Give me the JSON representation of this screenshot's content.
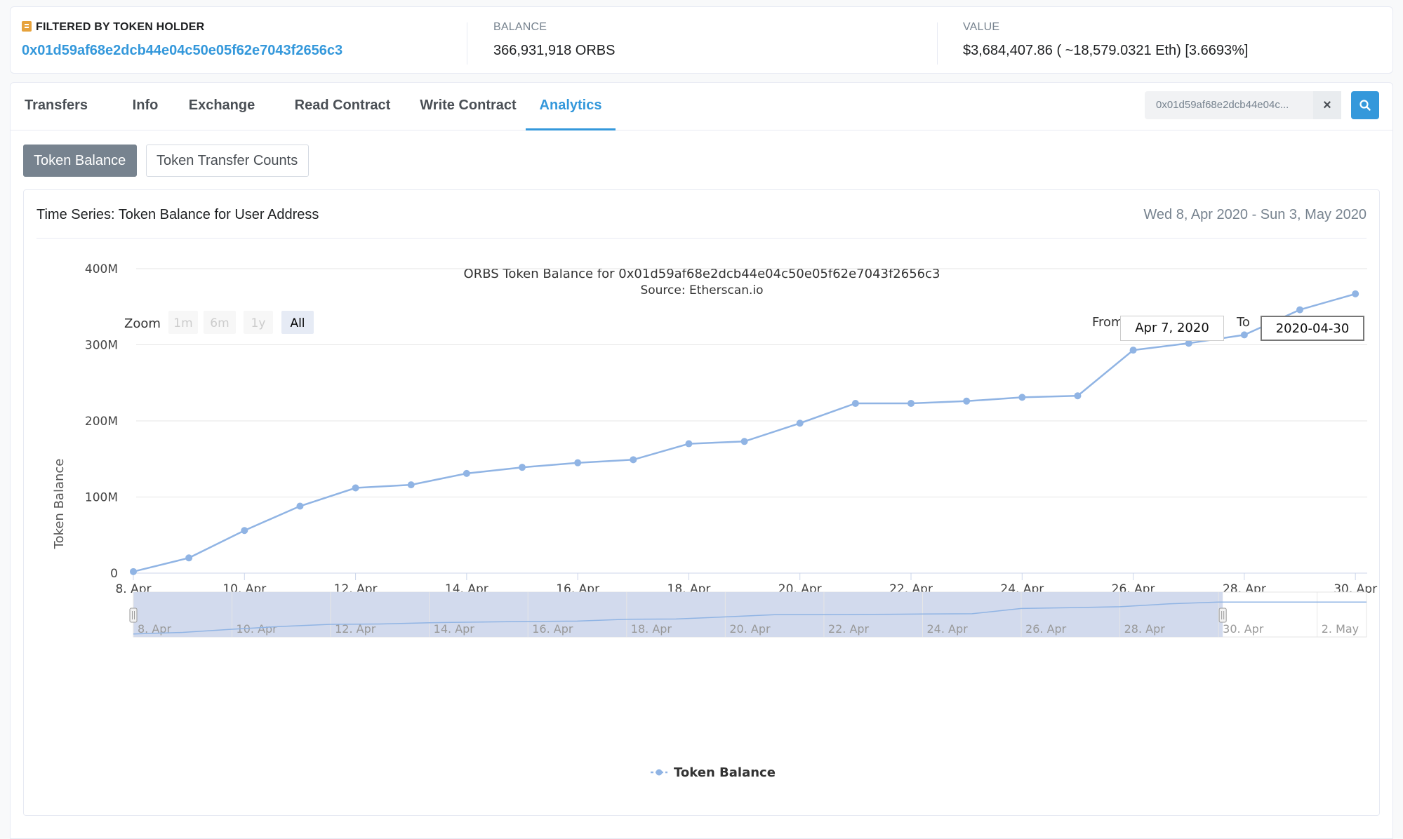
{
  "header": {
    "filter_label": "FILTERED BY TOKEN HOLDER",
    "holder_address": "0x01d59af68e2dcb44e04c50e05f62e7043f2656c3",
    "balance_label": "BALANCE",
    "balance_value": "366,931,918 ORBS",
    "value_label": "VALUE",
    "value_value": "$3,684,407.86 ( ~18,579.0321 Eth) [3.6693%]"
  },
  "tabs": [
    {
      "label": "Transfers"
    },
    {
      "label": "Info"
    },
    {
      "label": "Exchange"
    },
    {
      "label": "Read Contract"
    },
    {
      "label": "Write Contract"
    },
    {
      "label": "Analytics"
    }
  ],
  "search": {
    "value": "0x01d59af68e2dcb44e04c...",
    "clear_glyph": "×",
    "icon": "search-icon"
  },
  "subtabs": {
    "token_balance": "Token Balance",
    "transfer_counts": "Token Transfer Counts"
  },
  "panel": {
    "title": "Time Series: Token Balance for User Address",
    "range": "Wed 8, Apr 2020 - Sun 3, May 2020"
  },
  "zoom": {
    "label": "Zoom",
    "buttons": [
      "1m",
      "6m",
      "1y",
      "All"
    ],
    "active": "All",
    "from_label": "From",
    "from_value": "Apr 7, 2020",
    "to_label": "To",
    "to_value": "2020-04-30"
  },
  "colors": {
    "accent": "#3498db",
    "series": "#90b4e4",
    "navigator_fill": "#d0d8ec"
  },
  "chart_data": {
    "type": "line",
    "title": "ORBS Token Balance for 0x01d59af68e2dcb44e04c50e05f62e7043f2656c3",
    "subtitle": "Source: Etherscan.io",
    "xlabel": "",
    "ylabel": "Token Balance",
    "ylim": [
      0,
      400000000
    ],
    "y_ticks": [
      "0",
      "100M",
      "200M",
      "300M",
      "400M"
    ],
    "x_ticks": [
      "8. Apr",
      "10. Apr",
      "12. Apr",
      "14. Apr",
      "16. Apr",
      "18. Apr",
      "20. Apr",
      "22. Apr",
      "24. Apr",
      "26. Apr",
      "28. Apr",
      "30. Apr"
    ],
    "grid": true,
    "legend_position": "bottom-center",
    "series": [
      {
        "name": "Token Balance",
        "x": [
          "2020-04-08",
          "2020-04-09",
          "2020-04-10",
          "2020-04-11",
          "2020-04-12",
          "2020-04-13",
          "2020-04-14",
          "2020-04-15",
          "2020-04-16",
          "2020-04-17",
          "2020-04-18",
          "2020-04-19",
          "2020-04-20",
          "2020-04-21",
          "2020-04-22",
          "2020-04-23",
          "2020-04-24",
          "2020-04-25",
          "2020-04-26",
          "2020-04-27",
          "2020-04-28",
          "2020-04-29",
          "2020-04-30"
        ],
        "values": [
          2000000,
          20000000,
          56000000,
          88000000,
          112000000,
          116000000,
          131000000,
          139000000,
          145000000,
          149000000,
          170000000,
          173000000,
          197000000,
          223000000,
          223000000,
          226000000,
          231000000,
          233000000,
          293000000,
          302000000,
          313000000,
          346000000,
          366931918
        ]
      }
    ],
    "navigator": {
      "x_ticks": [
        "8. Apr",
        "10. Apr",
        "12. Apr",
        "14. Apr",
        "16. Apr",
        "18. Apr",
        "20. Apr",
        "22. Apr",
        "24. Apr",
        "26. Apr",
        "28. Apr",
        "30. Apr",
        "2. May"
      ],
      "selected_range": [
        "2020-04-08",
        "2020-04-30"
      ]
    }
  }
}
